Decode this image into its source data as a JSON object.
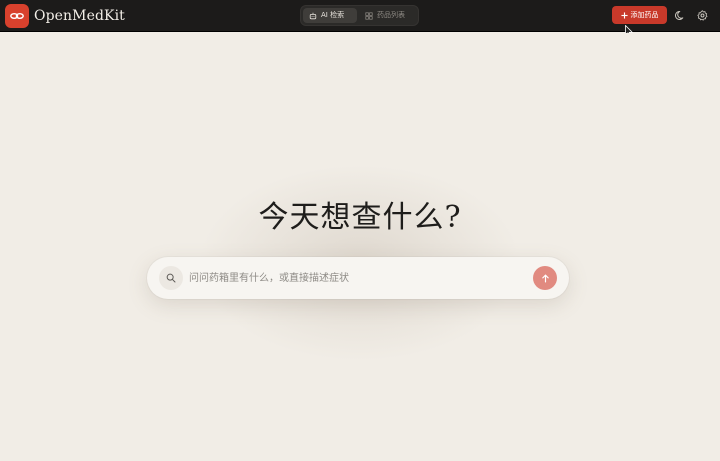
{
  "header": {
    "brand": "OpenMedKit",
    "tabs": [
      {
        "label": "AI 检索",
        "icon": "robot-icon",
        "active": true
      },
      {
        "label": "药品列表",
        "icon": "grid-icon",
        "active": false
      }
    ],
    "add_button_label": "添加药品",
    "accent_color": "#c8392a"
  },
  "main": {
    "headline": "今天想查什么?",
    "search": {
      "placeholder": "问问药箱里有什么，或直接描述症状",
      "value": ""
    }
  }
}
